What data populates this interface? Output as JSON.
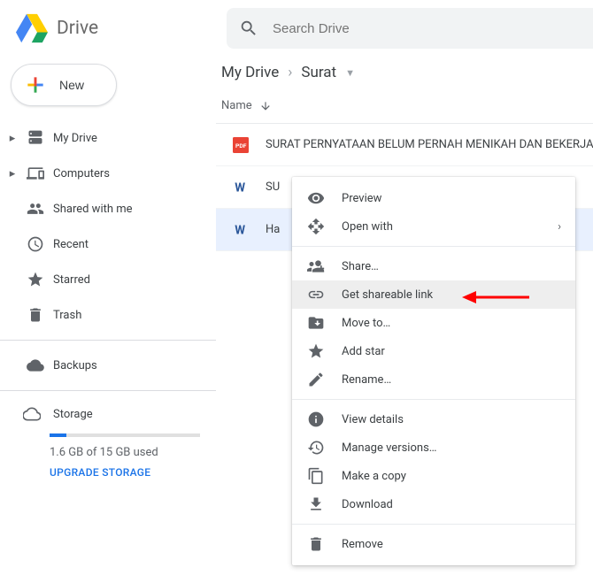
{
  "header": {
    "app_name": "Drive",
    "search_placeholder": "Search Drive"
  },
  "sidebar": {
    "new_label": "New",
    "items": [
      {
        "label": "My Drive",
        "icon": "drive",
        "expandable": true
      },
      {
        "label": "Computers",
        "icon": "computers",
        "expandable": true
      },
      {
        "label": "Shared with me",
        "icon": "shared",
        "expandable": false
      },
      {
        "label": "Recent",
        "icon": "recent",
        "expandable": false
      },
      {
        "label": "Starred",
        "icon": "star",
        "expandable": false
      },
      {
        "label": "Trash",
        "icon": "trash",
        "expandable": false
      }
    ],
    "backups_label": "Backups",
    "storage": {
      "title": "Storage",
      "used_text": "1.6 GB of 15 GB used",
      "upgrade_label": "UPGRADE STORAGE",
      "percent_used": 11
    }
  },
  "main": {
    "breadcrumb": [
      "My Drive",
      "Surat"
    ],
    "column_header": "Name",
    "files": [
      {
        "name": "SURAT PERNYATAAN BELUM PERNAH MENIKAH DAN BEKERJA",
        "type": "pdf"
      },
      {
        "name": "SU",
        "type": "word"
      },
      {
        "name": "Ha",
        "type": "word",
        "selected": true
      }
    ]
  },
  "context_menu": {
    "items": [
      {
        "label": "Preview",
        "icon": "eye"
      },
      {
        "label": "Open with",
        "icon": "openwith",
        "submenu": true
      },
      "sep",
      {
        "label": "Share…",
        "icon": "share"
      },
      {
        "label": "Get shareable link",
        "icon": "link",
        "highlight": true
      },
      {
        "label": "Move to…",
        "icon": "moveto"
      },
      {
        "label": "Add star",
        "icon": "star"
      },
      {
        "label": "Rename…",
        "icon": "rename"
      },
      "sep",
      {
        "label": "View details",
        "icon": "info"
      },
      {
        "label": "Manage versions…",
        "icon": "history"
      },
      {
        "label": "Make a copy",
        "icon": "copy"
      },
      {
        "label": "Download",
        "icon": "download"
      },
      "sep",
      {
        "label": "Remove",
        "icon": "trash"
      }
    ]
  }
}
